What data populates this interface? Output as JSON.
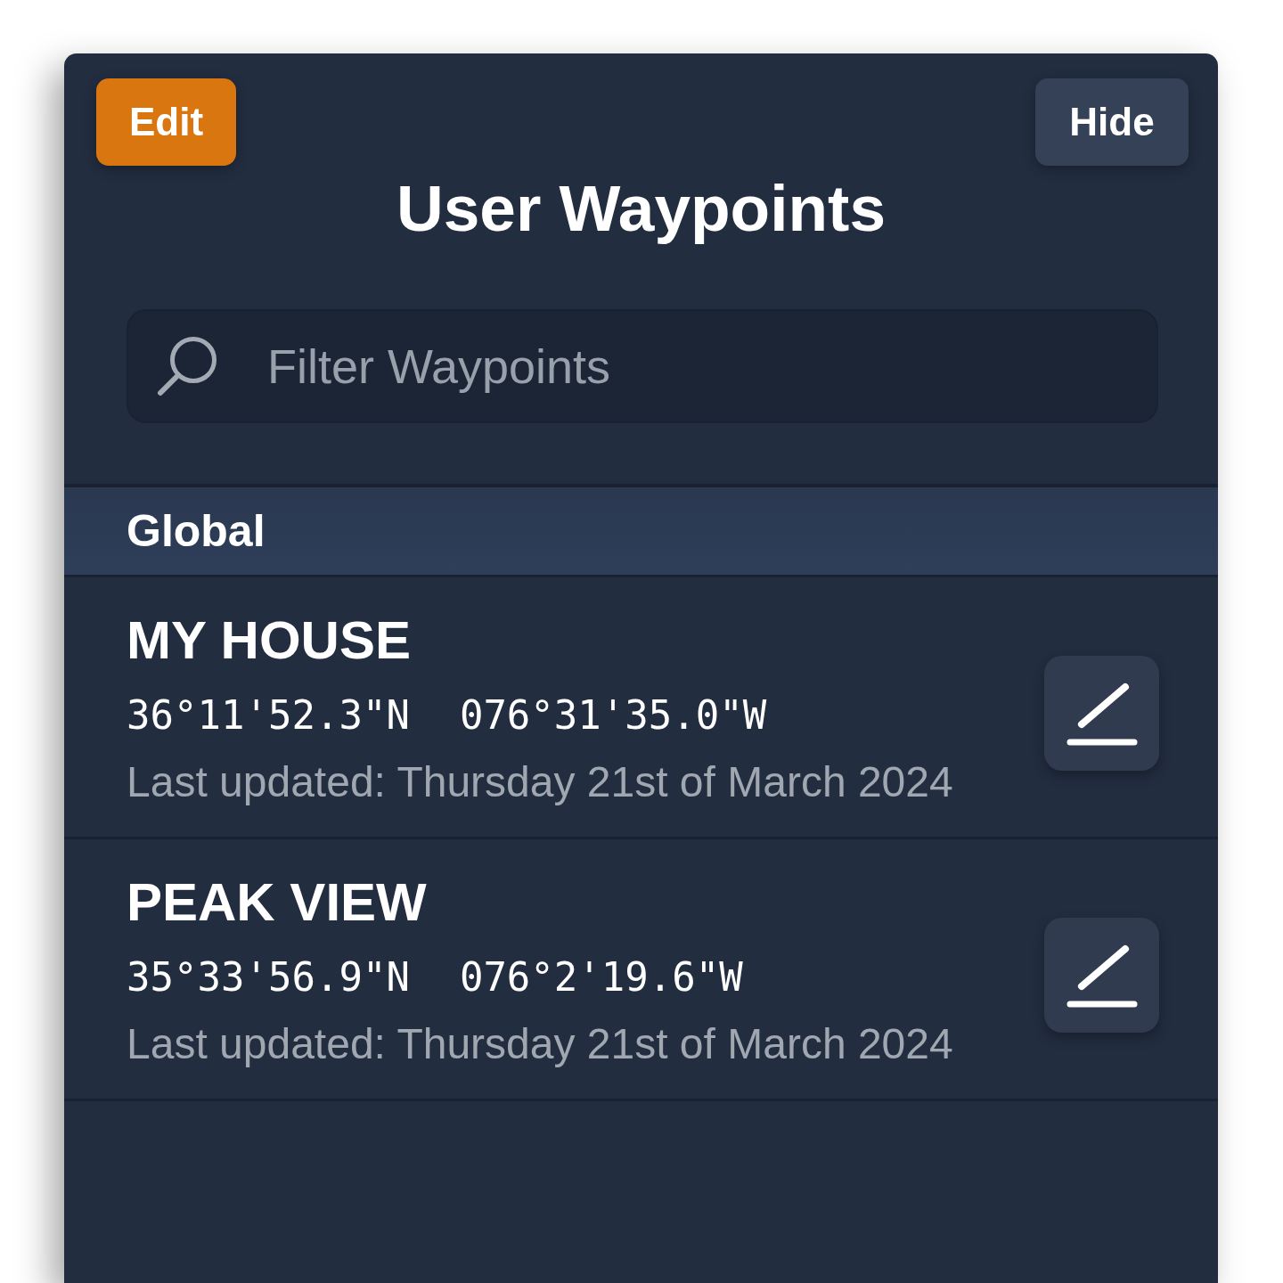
{
  "header": {
    "left_button": "Edit",
    "title": "User Waypoints",
    "right_button": "Hide"
  },
  "search": {
    "placeholder": "Filter Waypoints"
  },
  "sections": [
    {
      "title": "Global",
      "waypoints": [
        {
          "name": "MY HOUSE",
          "latitude": "36°11'52.3\"N",
          "longitude": "076°31'35.0\"W",
          "last_updated": "Last updated: Thursday 21st of March 2024"
        },
        {
          "name": "PEAK VIEW",
          "latitude": "35°33'56.9\"N",
          "longitude": "076°2'19.6\"W",
          "last_updated": "Last updated: Thursday 21st of March 2024"
        }
      ]
    }
  ]
}
